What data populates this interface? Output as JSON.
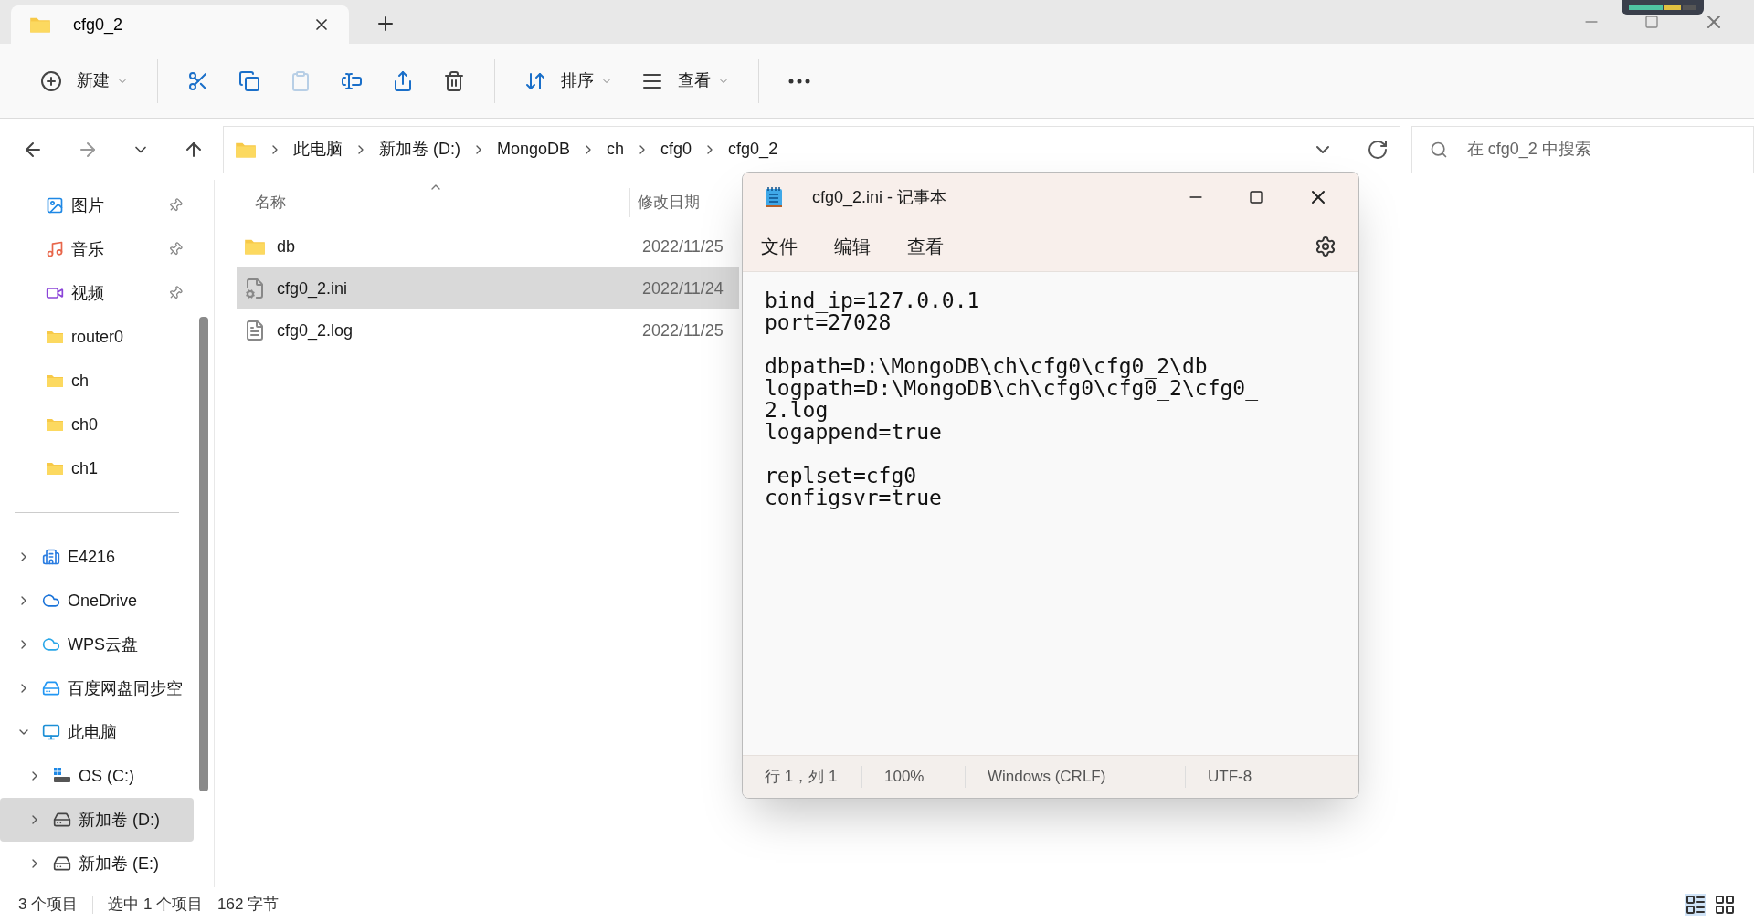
{
  "explorer": {
    "tab": {
      "title": "cfg0_2"
    },
    "toolbar": [
      {
        "kind": "new",
        "label": "新建"
      },
      {
        "kind": "cut"
      },
      {
        "kind": "copy"
      },
      {
        "kind": "paste",
        "disabled": true
      },
      {
        "kind": "rename"
      },
      {
        "kind": "share"
      },
      {
        "kind": "delete"
      },
      {
        "kind": "sort",
        "label": "排序"
      },
      {
        "kind": "view",
        "label": "查看"
      },
      {
        "kind": "more"
      }
    ],
    "breadcrumb": [
      "此电脑",
      "新加卷 (D:)",
      "MongoDB",
      "ch",
      "cfg0",
      "cfg0_2"
    ],
    "search": {
      "placeholder": "在 cfg0_2 中搜索"
    },
    "quick_access": [
      {
        "label": "图片",
        "kind": "pictures",
        "pinned": true
      },
      {
        "label": "音乐",
        "kind": "music",
        "pinned": true
      },
      {
        "label": "视频",
        "kind": "video",
        "pinned": true
      },
      {
        "label": "router0",
        "kind": "folder",
        "pinned": false
      },
      {
        "label": "ch",
        "kind": "folder",
        "pinned": false
      },
      {
        "label": "ch0",
        "kind": "folder",
        "pinned": false
      },
      {
        "label": "ch1",
        "kind": "folder",
        "pinned": false
      }
    ],
    "tree": [
      {
        "label": "E4216",
        "kind": "building",
        "expanded": false,
        "selected": false
      },
      {
        "label": "OneDrive",
        "kind": "cloud",
        "expanded": false,
        "selected": false
      },
      {
        "label": "WPS云盘",
        "kind": "cloud2",
        "expanded": false,
        "selected": false
      },
      {
        "label": "百度网盘同步空",
        "kind": "baidu",
        "expanded": false,
        "selected": false
      },
      {
        "label": "此电脑",
        "kind": "pc",
        "expanded": true,
        "selected": false,
        "children": [
          {
            "label": "OS (C:)",
            "kind": "osdrive",
            "expanded": false,
            "selected": false
          },
          {
            "label": "新加卷 (D:)",
            "kind": "drive",
            "expanded": false,
            "selected": true
          },
          {
            "label": "新加卷 (E:)",
            "kind": "drive",
            "expanded": false,
            "selected": false
          }
        ]
      }
    ],
    "columns": [
      "名称",
      "修改日期"
    ],
    "files": [
      {
        "name": "db",
        "kind": "folder",
        "date": "2022/11/25",
        "selected": false
      },
      {
        "name": "cfg0_2.ini",
        "kind": "config",
        "date": "2022/11/24",
        "selected": true
      },
      {
        "name": "cfg0_2.log",
        "kind": "text",
        "date": "2022/11/25",
        "selected": false
      }
    ],
    "status": [
      "3 个项目",
      "选中 1 个项目",
      "162 字节"
    ]
  },
  "notepad": {
    "title": "cfg0_2.ini - 记事本",
    "menu": [
      "文件",
      "编辑",
      "查看"
    ],
    "paragraphs": [
      [
        "bind_ip=127.0.0.1",
        "port=27028"
      ],
      [
        "dbpath=D:\\MongoDB\\ch\\cfg0\\cfg0_2\\db",
        "logpath=D:\\MongoDB\\ch\\cfg0\\cfg0_2\\cfg0_2.log",
        "logappend=true"
      ],
      [
        "replset=cfg0",
        "configsvr=true"
      ]
    ],
    "status": [
      "行 1，列 1",
      "100%",
      "Windows (CRLF)",
      "UTF-8"
    ]
  }
}
